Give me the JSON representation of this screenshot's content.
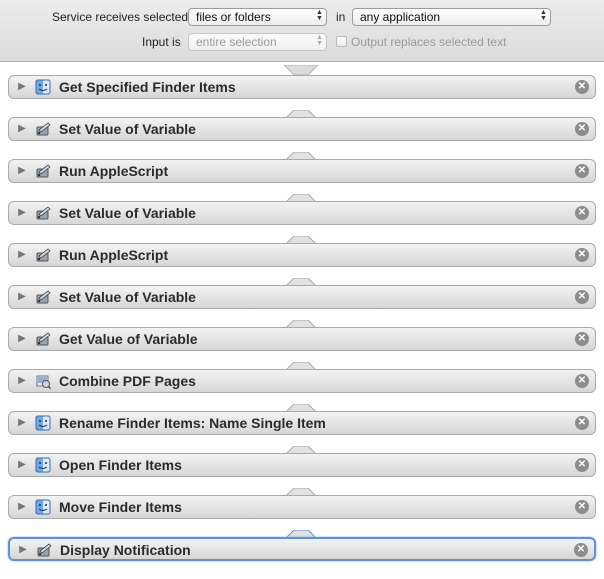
{
  "header": {
    "receives_label": "Service receives selected",
    "receives_value": "files or folders",
    "in_label": "in",
    "in_value": "any application",
    "input_is_label": "Input is",
    "input_is_value": "entire selection",
    "output_replaces_label": "Output replaces selected text",
    "output_replaces_checked": false
  },
  "actions": [
    {
      "title": "Get Specified Finder Items",
      "icon": "finder-icon"
    },
    {
      "title": "Set Value of Variable",
      "icon": "variable-tool-icon"
    },
    {
      "title": "Run AppleScript",
      "icon": "variable-tool-icon"
    },
    {
      "title": "Set Value of Variable",
      "icon": "variable-tool-icon"
    },
    {
      "title": "Run AppleScript",
      "icon": "variable-tool-icon"
    },
    {
      "title": "Set Value of Variable",
      "icon": "variable-tool-icon"
    },
    {
      "title": "Get Value of Variable",
      "icon": "variable-tool-icon"
    },
    {
      "title": "Combine PDF Pages",
      "icon": "preview-icon"
    },
    {
      "title": "Rename Finder Items: Name Single Item",
      "icon": "finder-icon"
    },
    {
      "title": "Open Finder Items",
      "icon": "finder-icon"
    },
    {
      "title": "Move Finder Items",
      "icon": "finder-icon"
    },
    {
      "title": "Display Notification",
      "icon": "variable-tool-icon",
      "selected": true
    }
  ],
  "colors": {
    "selection": "#5e91d6",
    "close_button": "#8c8c8c"
  }
}
